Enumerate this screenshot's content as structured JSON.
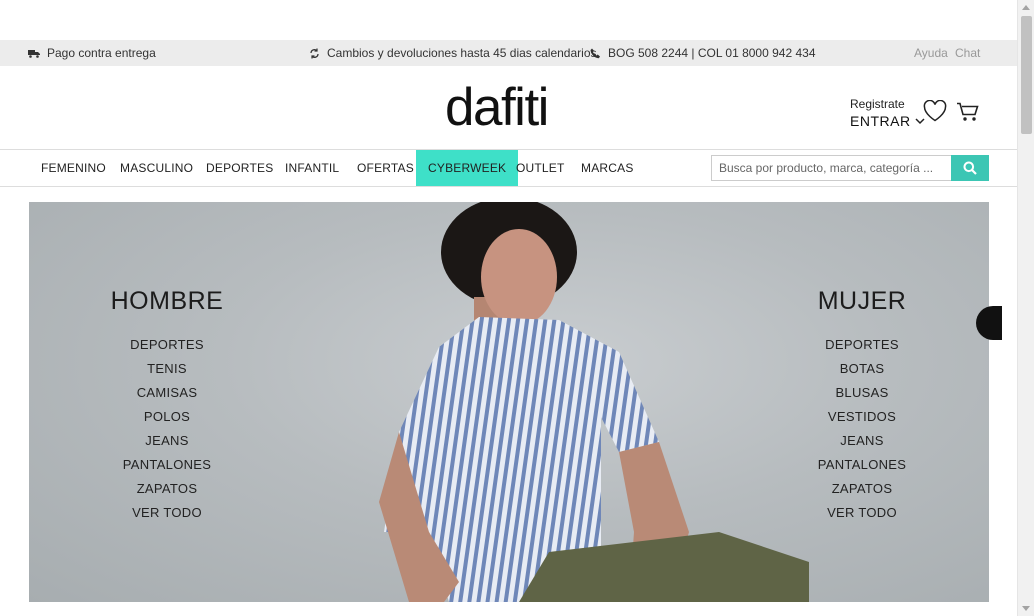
{
  "topbar": {
    "payment": "Pago contra entrega",
    "returns": "Cambios y devoluciones hasta 45 dias calendarios",
    "phone": "BOG 508 2244 | COL 01 8000 942 434",
    "help": "Ayuda",
    "chat": "Chat"
  },
  "header": {
    "logo": "dafiti",
    "register": "Registrate",
    "login": "ENTRAR"
  },
  "nav": {
    "items": [
      "FEMENINO",
      "MASCULINO",
      "DEPORTES",
      "INFANTIL",
      "OFERTAS",
      "CYBERWEEK",
      "OUTLET",
      "MARCAS"
    ],
    "search_placeholder": "Busca por producto, marca, categoría ..."
  },
  "hero": {
    "men": {
      "title": "HOMBRE",
      "links": [
        "DEPORTES",
        "TENIS",
        "CAMISAS",
        "POLOS",
        "JEANS",
        "PANTALONES",
        "ZAPATOS",
        "VER TODO"
      ]
    },
    "women": {
      "title": "MUJER",
      "links": [
        "DEPORTES",
        "BOTAS",
        "BLUSAS",
        "VESTIDOS",
        "JEANS",
        "PANTALONES",
        "ZAPATOS",
        "VER TODO"
      ]
    }
  },
  "colors": {
    "accent": "#3ee0c8",
    "search_button": "#3cc6b4",
    "topbar_bg": "#ececec"
  },
  "icons": [
    "truck-icon",
    "exchange-icon",
    "phone-icon",
    "heart-icon",
    "cart-icon",
    "search-icon",
    "chevron-down-icon"
  ]
}
